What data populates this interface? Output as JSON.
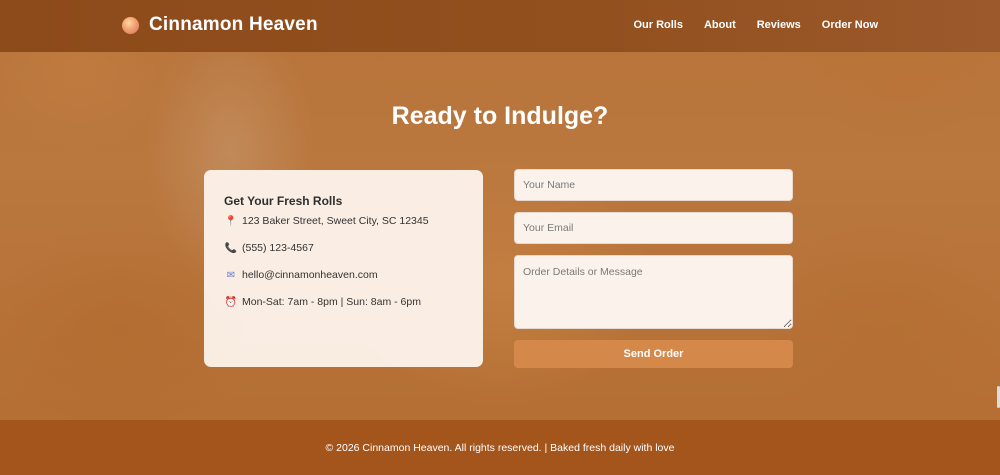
{
  "brand": {
    "name": "Cinnamon Heaven",
    "icon": "cinnamon-roll-icon"
  },
  "nav": {
    "items": [
      {
        "label": "Our Rolls"
      },
      {
        "label": "About"
      },
      {
        "label": "Reviews"
      },
      {
        "label": "Order Now"
      }
    ]
  },
  "hero": {
    "headline": "Ready to Indulge?"
  },
  "info": {
    "title": "Get Your Fresh Rolls",
    "address": "123 Baker Street, Sweet City, SC 12345",
    "phone": "(555) 123-4567",
    "email": "hello@cinnamonheaven.com",
    "hours": "Mon-Sat: 7am - 8pm | Sun: 8am - 6pm",
    "icons": [
      "map-pin-icon",
      "phone-icon",
      "envelope-icon",
      "alarm-clock-icon"
    ]
  },
  "form": {
    "name_placeholder": "Your Name",
    "name_value": "",
    "email_placeholder": "Your Email",
    "email_value": "",
    "message_placeholder": "Order Details or Message",
    "message_value": "",
    "submit_label": "Send Order"
  },
  "footer": {
    "text": "© 2026 Cinnamon Heaven. All rights reserved. | Baked fresh daily with love"
  },
  "colors": {
    "nav_bg": "#92501f",
    "footer_bg": "#a4551c",
    "button_bg": "#d4894a",
    "card_bg": "#fdf3ec"
  }
}
